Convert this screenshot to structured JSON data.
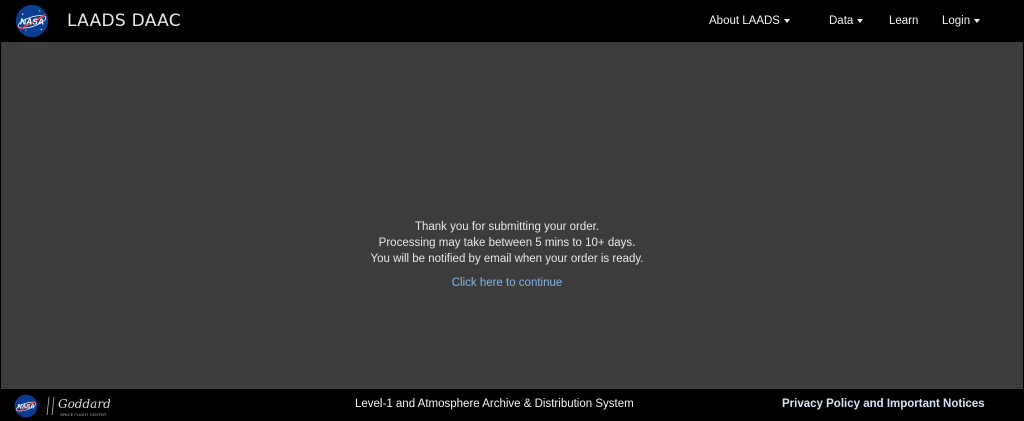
{
  "header": {
    "brand_title": "LAADS DAAC",
    "logo_text": "NASA",
    "nav": {
      "about_label": "About LAADS",
      "data_label": "Data",
      "learn_label": "Learn",
      "login_label": "Login"
    }
  },
  "main": {
    "message_lines": [
      "Thank you for submitting your order.",
      "Processing may take between 5 mins to 10+ days.",
      "You will be notified by email when your order is ready."
    ],
    "continue_link": "Click here to continue"
  },
  "footer": {
    "nasa_logo_text": "NASA",
    "goddard_logo_text": "Goddard",
    "goddard_logo_subtext": "SPACE FLIGHT CENTER",
    "system_name": "Level-1 and Atmosphere Archive & Distribution System",
    "privacy_link": "Privacy Policy and Important Notices"
  },
  "colors": {
    "header_bg": "#000000",
    "main_bg": "#3c3c3c",
    "link": "#7fb3e8",
    "footer_link": "#cfe3f7",
    "nasa_blue": "#0b3d91",
    "nasa_red": "#fc3d21"
  }
}
